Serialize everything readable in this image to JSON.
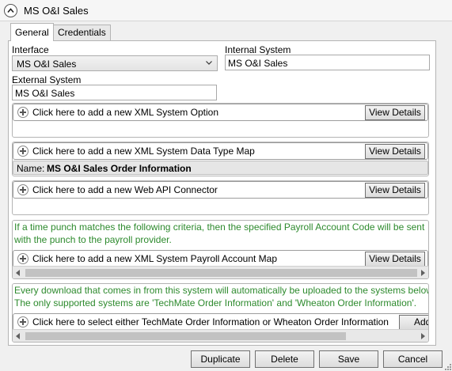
{
  "window": {
    "title": "MS O&I Sales"
  },
  "tabs": [
    {
      "label": "General",
      "active": true
    },
    {
      "label": "Credentials",
      "active": false
    }
  ],
  "general": {
    "interface_label": "Interface",
    "interface_value": "MS O&I Sales",
    "internal_system_label": "Internal System",
    "internal_system_value": "MS O&I Sales",
    "external_system_label": "External System",
    "external_system_value": "MS O&I Sales"
  },
  "sections": {
    "xml_option": {
      "add_text": "Click here to add a new XML System Option",
      "view_label": "View Details"
    },
    "data_type_map": {
      "add_text": "Click here to add a new XML System Data Type Map",
      "view_label": "View Details",
      "name_label": "Name:",
      "name_value": "MS O&I Sales Order Information"
    },
    "web_api": {
      "add_text": "Click here to add a new Web API Connector",
      "view_label": "View Details"
    },
    "payroll": {
      "info_line1": "If a time punch matches the following criteria, then the specified Payroll Account Code will be sent",
      "info_line2": "with the punch to the payroll provider.",
      "add_text": "Click here to add a new XML System Payroll Account Map",
      "view_label": "View Details"
    },
    "download": {
      "info_line1": "Every download that comes in from this system will automatically be uploaded to the systems below",
      "info_line2": "The only supported systems are 'TechMate Order Information' and 'Wheaton Order Information'.",
      "add_text": "Click here to select either TechMate Order Information or Wheaton Order Information",
      "add_button_label": "Add A"
    }
  },
  "footer": {
    "duplicate_label": "Duplicate",
    "delete_label": "Delete",
    "save_label": "Save",
    "cancel_label": "Cancel"
  },
  "colors": {
    "info_text": "#2d8a2d",
    "border": "#b4b4b4"
  }
}
